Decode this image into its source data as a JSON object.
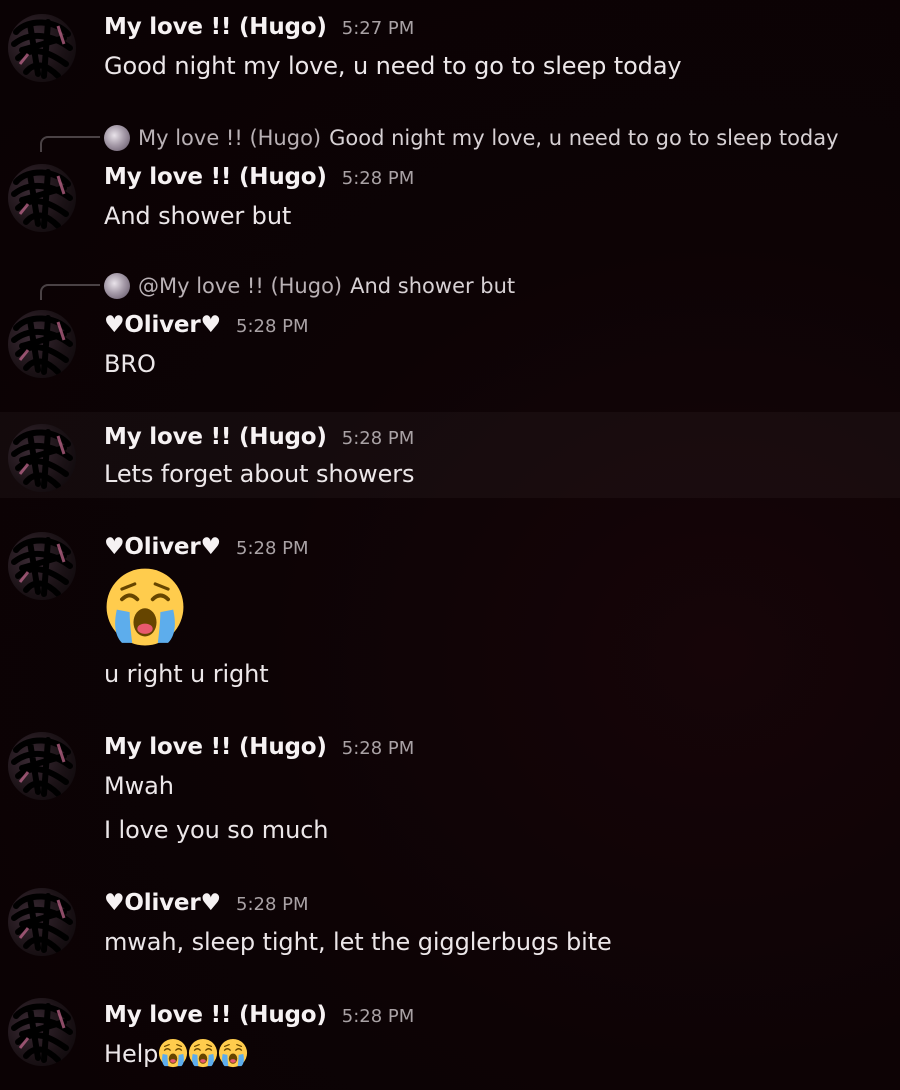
{
  "messages": [
    {
      "author": "My love !! (Hugo)",
      "time": "5:27 PM",
      "lines": [
        "Good night my love, u need to go to sleep today"
      ]
    },
    {
      "reply": {
        "name": "My love !! (Hugo)",
        "text": "Good night my love, u need to go to sleep today"
      },
      "author": "My love !! (Hugo)",
      "time": "5:28 PM",
      "lines": [
        "And shower but"
      ]
    },
    {
      "reply": {
        "name": "@My love !! (Hugo)",
        "text": "And shower but"
      },
      "author": "♥Oliver♥",
      "time": "5:28 PM",
      "lines": [
        "BRO"
      ]
    },
    {
      "author": "My love !! (Hugo)",
      "time": "5:28 PM",
      "lines": [
        "Lets forget about showers"
      ]
    },
    {
      "author": "♥Oliver♥",
      "time": "5:28 PM",
      "emoji": "loudly-crying-face",
      "lines": [
        "u right u right"
      ]
    },
    {
      "author": "My love !! (Hugo)",
      "time": "5:28 PM",
      "lines": [
        "Mwah",
        "I love you so much"
      ]
    },
    {
      "author": "♥Oliver♥",
      "time": "5:28 PM",
      "lines": [
        "mwah, sleep tight, let the gigglerbugs bite"
      ]
    },
    {
      "author": "My love !! (Hugo)",
      "time": "5:28 PM",
      "lines": [
        "Help"
      ],
      "trailing_emoji": [
        "loudly-crying-face",
        "loudly-crying-face",
        "loudly-crying-face"
      ]
    }
  ],
  "colors": {
    "background": "#0c0305",
    "author": "#f6f2f3",
    "timestamp": "#a9a2a5",
    "text": "#ece7e9"
  }
}
